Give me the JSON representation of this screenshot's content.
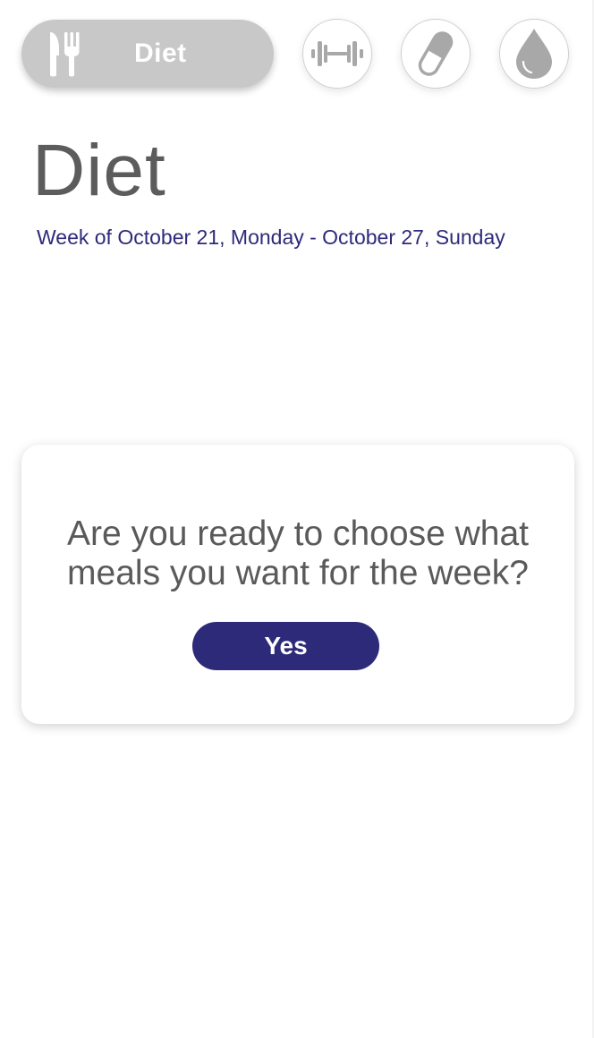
{
  "nav": {
    "active_tab_label": "Diet",
    "items": [
      {
        "id": "diet",
        "label": "Diet",
        "icon": "fork-knife-icon",
        "active": true
      },
      {
        "id": "exercise",
        "icon": "dumbbell-icon",
        "active": false
      },
      {
        "id": "medication",
        "icon": "pill-icon",
        "active": false
      },
      {
        "id": "water",
        "icon": "water-drop-icon",
        "active": false
      }
    ]
  },
  "header": {
    "title": "Diet",
    "week_range": "Week of October 21, Monday - October 27, Sunday"
  },
  "prompt_card": {
    "question": "Are you ready to choose what meals you want for the week?",
    "yes_label": "Yes"
  },
  "colors": {
    "accent": "#2e2a7a",
    "active_tab_bg": "#c8c8c8",
    "icon_gray": "#a8a8a8",
    "title_text": "#5c5c5c",
    "body_text": "#5a5a5a",
    "background": "#ffffff"
  }
}
